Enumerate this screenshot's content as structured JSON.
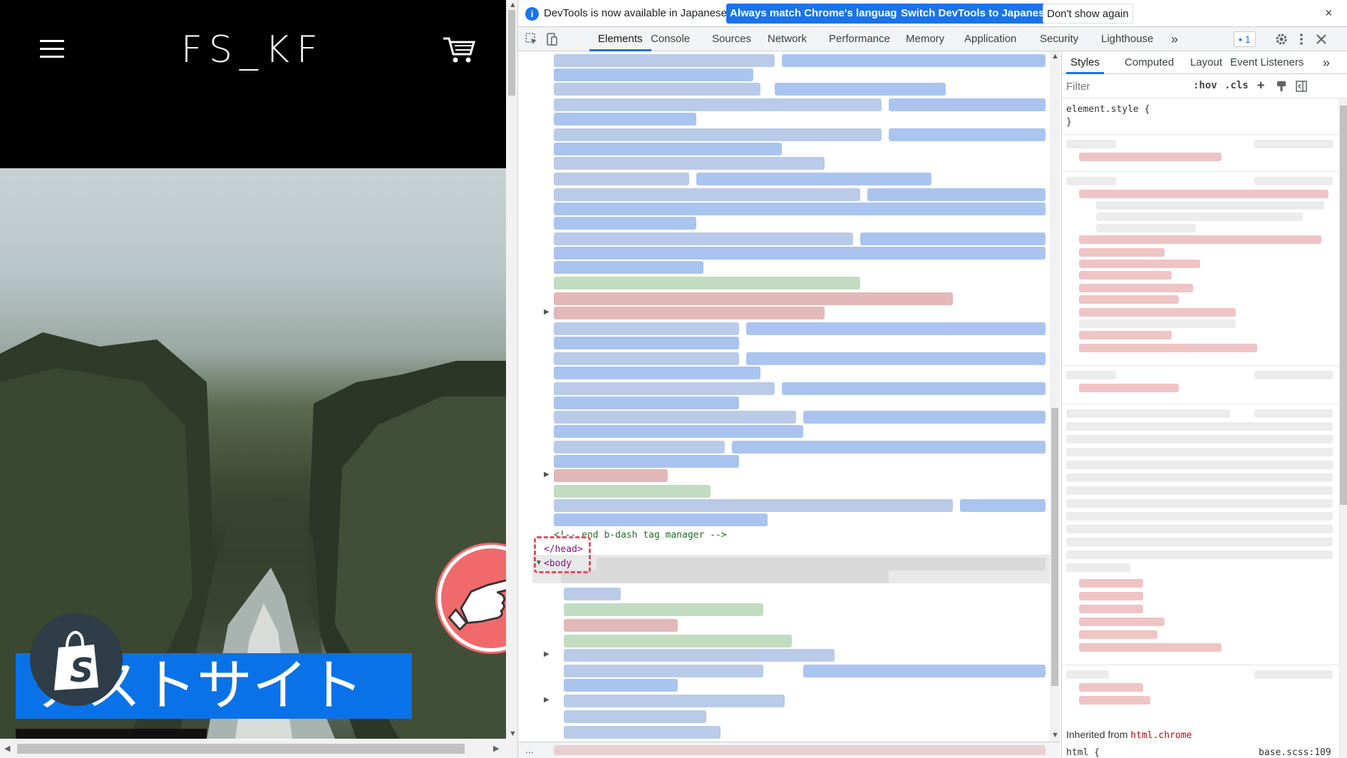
{
  "site": {
    "logo": "FS_KF",
    "hero_title": "テストサイト",
    "icons": {
      "menu": "hamburger-icon",
      "cart": "cart-icon",
      "shopify": "shopify-bag-icon",
      "pointer": "pointing-hand-icon"
    }
  },
  "devtools": {
    "infobar": {
      "message": "DevTools is now available in Japanese!",
      "btn_match": "Always match Chrome's language",
      "btn_switch": "Switch DevTools to Japanese",
      "btn_dismiss": "Don't show again",
      "close": "×"
    },
    "tabs": [
      "Elements",
      "Console",
      "Sources",
      "Network",
      "Performance",
      "Memory",
      "Application",
      "Security",
      "Lighthouse"
    ],
    "more_tabs": "»",
    "issues_count": "1",
    "elements": {
      "comment_end": "<!-- end b-dash tag manager -->",
      "head_close": "</head>",
      "body_open": "<body",
      "footer_dots": "..."
    },
    "styles": {
      "tabs": [
        "Styles",
        "Computed",
        "Layout",
        "Event Listeners"
      ],
      "more": "»",
      "filter_placeholder": "Filter",
      "hov": ":hov",
      "cls": ".cls",
      "plus": "+",
      "element_style": "element.style {",
      "element_style_close": "}",
      "inherited_label": "Inherited from ",
      "inherited_tag": "html.chrome",
      "html_rule": "html {",
      "html_source": "base.scss:109"
    },
    "colors": {
      "accent": "#1a73e8",
      "highlight": "#e05060"
    }
  }
}
